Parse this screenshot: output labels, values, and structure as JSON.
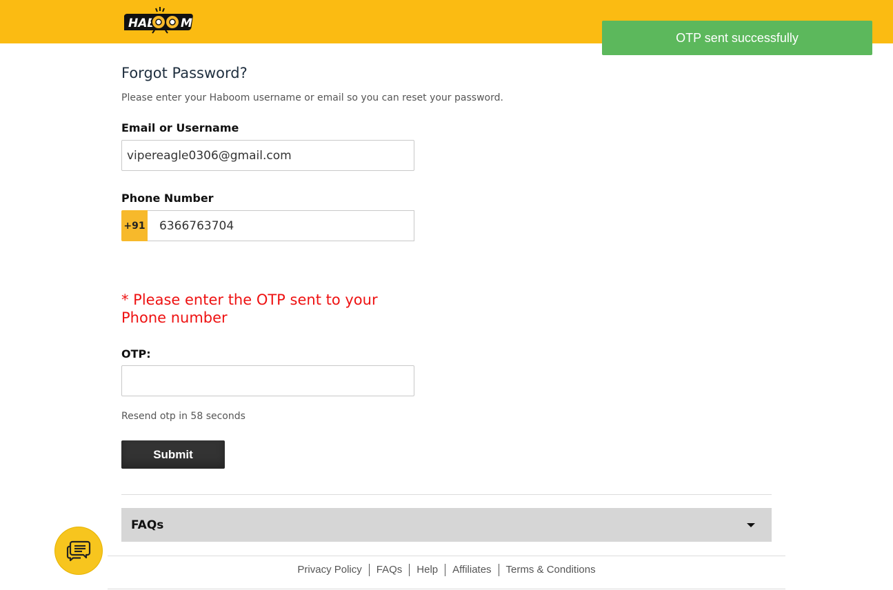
{
  "header": {
    "logo_text": "HABOOM",
    "brand_color": "#fbbb12"
  },
  "toast": {
    "message": "OTP sent successfully",
    "color": "#5cb85c"
  },
  "form": {
    "title": "Forgot Password?",
    "subtitle": "Please enter your Haboom username or email so you can reset your password.",
    "email_label": "Email or Username",
    "email_value": "vipereagle0306@gmail.com",
    "phone_label": "Phone Number",
    "phone_prefix": "+91",
    "phone_value": "6366763704",
    "otp_warning": "* Please enter the OTP sent to your Phone number",
    "otp_label": "OTP:",
    "otp_value": "",
    "resend_text": "Resend otp in 58 seconds",
    "submit_label": "Submit"
  },
  "faq": {
    "label": "FAQs"
  },
  "footer": {
    "links": [
      "Privacy Policy",
      "FAQs",
      "Help",
      "Affiliates",
      "Terms & Conditions"
    ]
  },
  "icons": {
    "chat": "chat-bubble-icon",
    "faq_toggle": "caret-down-icon"
  }
}
